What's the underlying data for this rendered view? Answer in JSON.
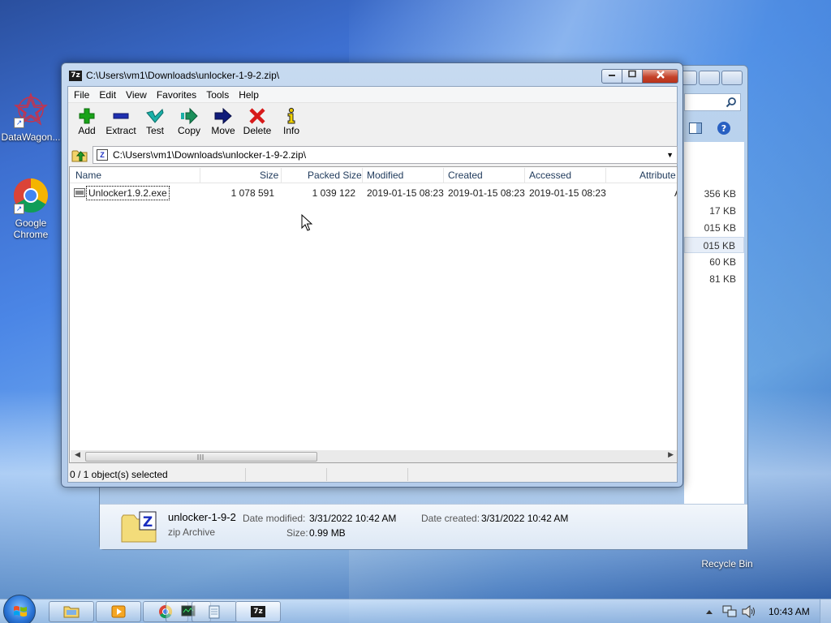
{
  "desktop": {
    "icons": [
      {
        "label": "DataWagon..."
      },
      {
        "label": "Google Chrome"
      },
      {
        "label": "Recycle Bin"
      }
    ]
  },
  "explorer": {
    "sizes": [
      "356 KB",
      "17 KB",
      "015 KB",
      "015 KB",
      "60 KB",
      "81 KB"
    ],
    "details": {
      "name": "unlocker-1-9-2",
      "type": "zip Archive",
      "modified_label": "Date modified:",
      "modified_value": "3/31/2022 10:42 AM",
      "created_label": "Date created:",
      "created_value": "3/31/2022 10:42 AM",
      "size_label": "Size:",
      "size_value": "0.99 MB"
    }
  },
  "window": {
    "title": "C:\\Users\\vm1\\Downloads\\unlocker-1-9-2.zip\\",
    "app_icon_text": "7z",
    "menu": [
      "File",
      "Edit",
      "View",
      "Favorites",
      "Tools",
      "Help"
    ],
    "toolbar": [
      "Add",
      "Extract",
      "Test",
      "Copy",
      "Move",
      "Delete",
      "Info"
    ],
    "address": "C:\\Users\\vm1\\Downloads\\unlocker-1-9-2.zip\\",
    "columns": [
      "Name",
      "Size",
      "Packed Size",
      "Modified",
      "Created",
      "Accessed",
      "Attribute"
    ],
    "rows": [
      {
        "name": "Unlocker1.9.2.exe",
        "size": "1 078 591",
        "packed": "1 039 122",
        "modified": "2019-01-15 08:23",
        "created": "2019-01-15 08:23",
        "accessed": "2019-01-15 08:23",
        "attr": "A"
      }
    ],
    "status": "0 / 1 object(s) selected"
  },
  "taskbar": {
    "clock": "10:43 AM",
    "active_item_text": "7z"
  },
  "colors": {
    "add": "#19a319",
    "extract": "#1f2fb0",
    "test": "#1ab0a8",
    "move": "#101c7a",
    "delete": "#d71a1a",
    "close_button": "#c4422a"
  }
}
